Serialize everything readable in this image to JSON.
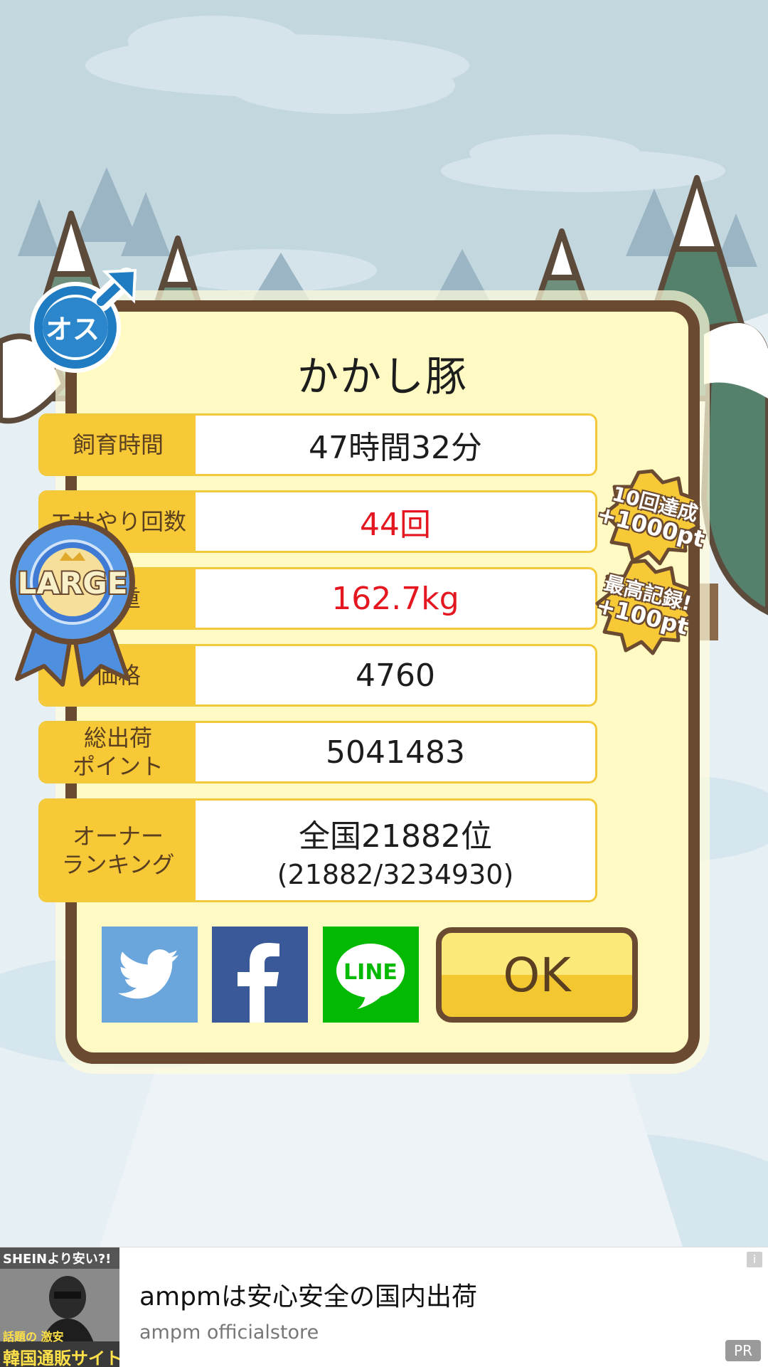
{
  "result": {
    "name": "かかし豚",
    "stats": [
      {
        "label": "飼育時間",
        "value": "47時間32分",
        "highlight": false
      },
      {
        "label": "エサやり回数",
        "value": "44回",
        "highlight": true
      },
      {
        "label": "体重",
        "value": "162.7kg",
        "highlight": true
      },
      {
        "label": "価格",
        "value": "4760",
        "highlight": false
      },
      {
        "label_line1": "総出荷",
        "label_line2": "ポイント",
        "value": "5041483",
        "highlight": false
      },
      {
        "label_line1": "オーナー",
        "label_line2": "ランキング",
        "value": "全国21882位",
        "value_sub": "(21882/3234930)",
        "highlight": false
      }
    ]
  },
  "badges": {
    "sex": "オス",
    "size": "LARGE",
    "feed_bonus_line1": "10回達成",
    "feed_bonus_line2": "+1000pt",
    "record_bonus_line1": "最高記録!",
    "record_bonus_line2": "+100pt"
  },
  "buttons": {
    "ok": "OK",
    "line": "LINE"
  },
  "ad": {
    "title": "ampmは安心安全の国内出荷",
    "sponsor": "ampm officialstore",
    "pr_label": "PR",
    "info_icon": "i",
    "thumb_text_top": "SHEINより安い?!",
    "thumb_text_mid": "話題の 激安",
    "thumb_text_bottom": "韓国通販サイト"
  },
  "colors": {
    "frame_brown": "#6b4a32",
    "card_bg": "#fff9c4",
    "label_yellow": "#f7c937",
    "highlight_red": "#e4161f",
    "twitter_blue": "#6aa6dc",
    "facebook_blue": "#3a5998",
    "line_green": "#03b902"
  }
}
